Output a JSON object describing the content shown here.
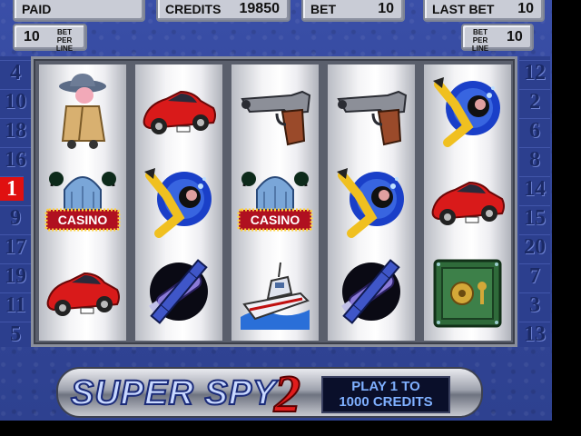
{
  "header": {
    "paid_label": "PAID",
    "credits_label": "CREDITS",
    "credits_value": "19850",
    "bet_label": "BET",
    "bet_value": "10",
    "last_bet_label": "LAST BET",
    "last_bet_value": "10"
  },
  "bet_per_line": {
    "left_value": "10",
    "right_value": "10",
    "caption_line1": "BET",
    "caption_line2": "PER LINE"
  },
  "paylines": {
    "left": [
      "4",
      "10",
      "18",
      "16",
      "1",
      "9",
      "17",
      "19",
      "11",
      "5"
    ],
    "right": [
      "12",
      "2",
      "6",
      "8",
      "14",
      "15",
      "20",
      "7",
      "3",
      "13"
    ],
    "active_left": "1"
  },
  "reels": [
    [
      "spy-detective-icon",
      "casino-icon",
      "red-car-icon"
    ],
    [
      "red-car-icon",
      "diver-icon",
      "satellite-icon"
    ],
    [
      "pistol-icon",
      "casino-icon",
      "speedboat-icon"
    ],
    [
      "pistol-icon",
      "diver-icon",
      "satellite-icon"
    ],
    [
      "diver-icon",
      "red-car-icon",
      "safe-icon"
    ]
  ],
  "casino_sign": "CASINO",
  "logo": {
    "title": "SUPER SPY",
    "number": "2",
    "promo_line1": "PLAY 1 TO",
    "promo_line2": "1000 CREDITS"
  },
  "colors": {
    "background": "#3a4fa8",
    "active_line": "#e01010",
    "logo_red": "#e11c1c"
  }
}
